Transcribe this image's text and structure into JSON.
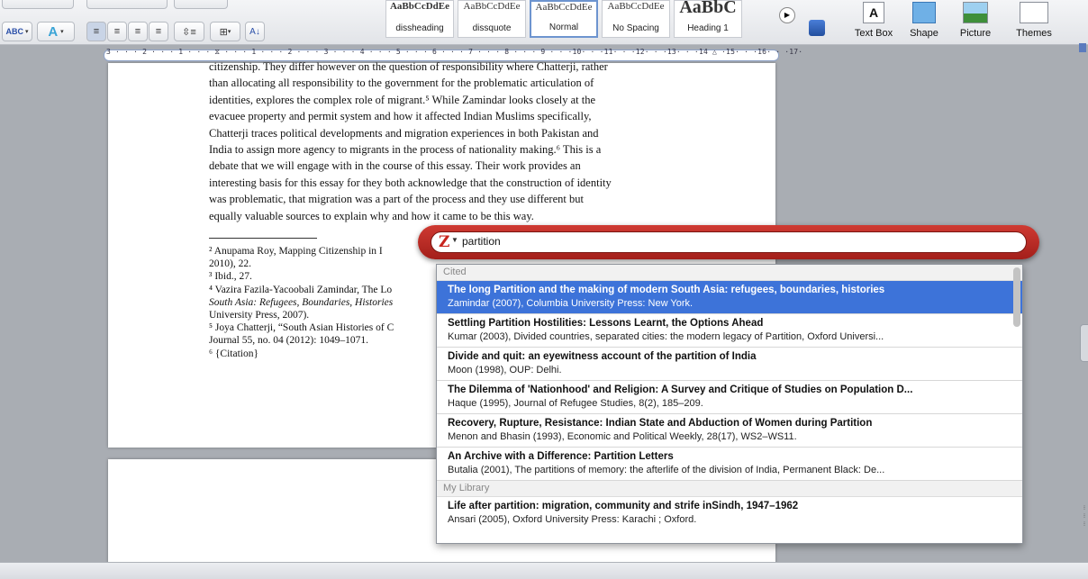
{
  "ribbon": {
    "styles": [
      {
        "preview": "AaBbCcDdEe",
        "name": "dissheading"
      },
      {
        "preview": "AaBbCcDdEe",
        "name": "dissquote"
      },
      {
        "preview": "AaBbCcDdEe",
        "name": "Normal"
      },
      {
        "preview": "AaBbCcDdEe",
        "name": "No Spacing"
      },
      {
        "preview": "AaBbC",
        "name": "Heading 1"
      }
    ],
    "insert": {
      "text_box": "Text Box",
      "shape": "Shape",
      "picture": "Picture",
      "themes": "Themes"
    }
  },
  "ruler": {
    "text": "3 · · · 2 · · · 1 · · · ⧖ · · · 1 · · · 2 · · · 3 · · · 4 · · · 5 · · · 6 · · · 7 · · · 8 · · · 9 · · ·10· · ·11· · ·12· · ·13· · ·14 △ ·15· · ·16· · ·17·"
  },
  "document": {
    "paragraph_lines": [
      "citizenship. They differ however on the question of responsibility where Chatterji, rather",
      "than allocating all responsibility to the government for the problematic articulation of",
      "identities, explores the complex role of migrant.⁵ While Zamindar looks closely at the",
      "evacuee property and permit system and how it affected Indian Muslims specifically,",
      "Chatterji traces political developments and migration experiences in both Pakistan and",
      "India to assign more agency to migrants in the process of nationality making.⁶ This is a",
      "debate that we will engage with in the course of this essay. Their work provides an",
      "interesting basis for this essay for they both acknowledge that the construction of identity",
      "was problematic, that migration was a part of the process and they use different but",
      "equally valuable sources to explain why and how it came to be this way."
    ],
    "footnotes": [
      "² Anupama Roy, Mapping Citizenship in I",
      "2010), 22.",
      "³ Ibid., 27.",
      "⁴ Vazira Fazila-Yacoobali Zamindar, The Lo",
      "South Asia: Refugees, Boundaries, Histories",
      "University Press, 2007).",
      "⁵ Joya Chatterji, “South Asian Histories of C",
      "Journal 55, no. 04 (2012): 1049–1071.",
      "⁶ {Citation}"
    ]
  },
  "zotero": {
    "query": "partition",
    "section_cited": "Cited",
    "section_library": "My Library",
    "cited_items": [
      {
        "title": "The long Partition and the making of modern South Asia: refugees, boundaries, histories",
        "subtitle": "Zamindar (2007), Columbia University Press: New York."
      },
      {
        "title": "Settling Partition Hostilities: Lessons Learnt, the Options Ahead",
        "subtitle": "Kumar (2003), Divided countries, separated cities: the modern legacy of Partition, Oxford Universi..."
      },
      {
        "title": "Divide and quit: an eyewitness account of the partition of India",
        "subtitle": "Moon (1998), OUP: Delhi."
      },
      {
        "title": "The Dilemma of 'Nationhood' and Religion: A Survey and Critique of Studies on Population D...",
        "subtitle": "Haque (1995), Journal of Refugee Studies, 8(2), 185–209."
      },
      {
        "title": "Recovery, Rupture, Resistance: Indian State and Abduction of Women during Partition",
        "subtitle": "Menon and Bhasin (1993), Economic and Political Weekly, 28(17), WS2–WS11."
      },
      {
        "title": "An Archive with a Difference: Partition Letters",
        "subtitle": "Butalia (2001), The partitions of memory: the afterlife of the division of India, Permanent Black: De..."
      }
    ],
    "library_items": [
      {
        "title": "Life after partition: migration, community and strife inSindh, 1947–1962",
        "subtitle": "Ansari (2005), Oxford University Press: Karachi ; Oxford."
      }
    ]
  }
}
